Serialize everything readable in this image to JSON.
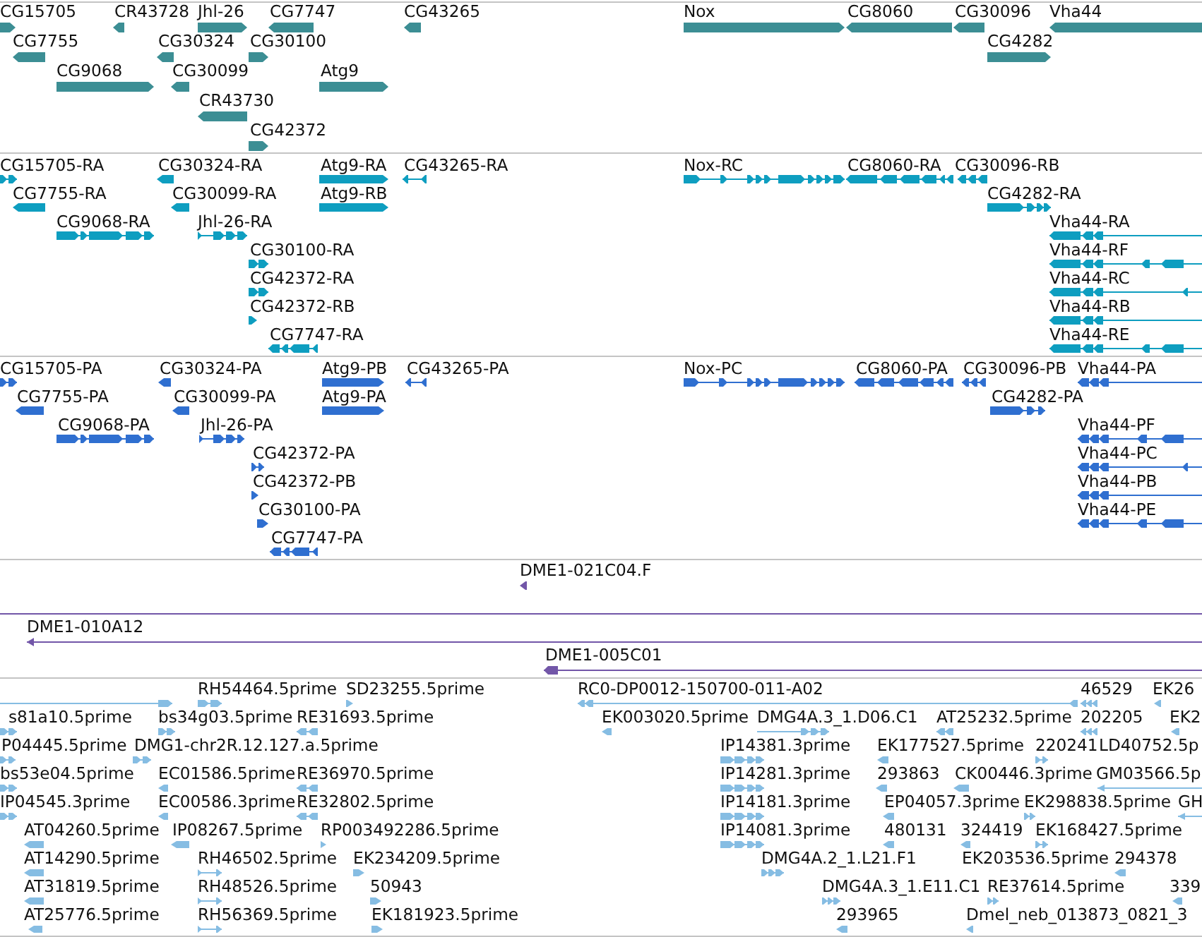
{
  "tracks": [
    {
      "kind": "gene",
      "color": "#3c8e94",
      "features": [
        {
          "label": "CG15705",
          "reverse": false
        },
        {
          "label": "CR43728",
          "reverse": true
        },
        {
          "label": "Jhl-26",
          "reverse": false
        },
        {
          "label": "CG7747",
          "reverse": true
        },
        {
          "label": "CG43265",
          "reverse": true
        },
        {
          "label": "Nox",
          "reverse": false
        },
        {
          "label": "CG8060",
          "reverse": true
        },
        {
          "label": "CG30096",
          "reverse": true
        },
        {
          "label": "Vha44",
          "reverse": true
        },
        {
          "label": "CG7755",
          "reverse": true
        },
        {
          "label": "CG30324",
          "reverse": true
        },
        {
          "label": "CG30100",
          "reverse": false
        },
        {
          "label": "CG4282",
          "reverse": false
        },
        {
          "label": "CG9068",
          "reverse": false
        },
        {
          "label": "CG30099",
          "reverse": true
        },
        {
          "label": "Atg9",
          "reverse": false
        },
        {
          "label": "CR43730",
          "reverse": true
        },
        {
          "label": "CG42372",
          "reverse": false
        }
      ]
    },
    {
      "kind": "transcript",
      "color": "#0e9ec0",
      "features": [
        {
          "label": "CG15705-RA",
          "reverse": false
        },
        {
          "label": "CG30324-RA",
          "reverse": true
        },
        {
          "label": "Atg9-RA",
          "reverse": false
        },
        {
          "label": "CG43265-RA",
          "reverse": true
        },
        {
          "label": "Nox-RC",
          "reverse": false
        },
        {
          "label": "CG8060-RA",
          "reverse": true
        },
        {
          "label": "CG30096-RB",
          "reverse": true
        },
        {
          "label": "CG7755-RA",
          "reverse": true
        },
        {
          "label": "CG30099-RA",
          "reverse": true
        },
        {
          "label": "Atg9-RB",
          "reverse": false
        },
        {
          "label": "CG4282-RA",
          "reverse": false
        },
        {
          "label": "CG9068-RA",
          "reverse": false
        },
        {
          "label": "Jhl-26-RA",
          "reverse": false
        },
        {
          "label": "Vha44-RA",
          "reverse": true
        },
        {
          "label": "CG30100-RA",
          "reverse": false
        },
        {
          "label": "Vha44-RF",
          "reverse": true
        },
        {
          "label": "CG42372-RA",
          "reverse": false
        },
        {
          "label": "Vha44-RC",
          "reverse": true
        },
        {
          "label": "CG42372-RB",
          "reverse": false
        },
        {
          "label": "Vha44-RB",
          "reverse": true
        },
        {
          "label": "CG7747-RA",
          "reverse": true
        },
        {
          "label": "Vha44-RE",
          "reverse": true
        }
      ]
    },
    {
      "kind": "protein",
      "color": "#2f6fd0",
      "features": [
        {
          "label": "CG15705-PA",
          "reverse": false
        },
        {
          "label": "CG30324-PA",
          "reverse": true
        },
        {
          "label": "Atg9-PB",
          "reverse": false
        },
        {
          "label": "CG43265-PA",
          "reverse": true
        },
        {
          "label": "Nox-PC",
          "reverse": false
        },
        {
          "label": "CG8060-PA",
          "reverse": true
        },
        {
          "label": "CG30096-PB",
          "reverse": true
        },
        {
          "label": "Vha44-PA",
          "reverse": true
        },
        {
          "label": "CG7755-PA",
          "reverse": true
        },
        {
          "label": "CG30099-PA",
          "reverse": true
        },
        {
          "label": "Atg9-PA",
          "reverse": false
        },
        {
          "label": "CG4282-PA",
          "reverse": false
        },
        {
          "label": "CG9068-PA",
          "reverse": false
        },
        {
          "label": "Jhl-26-PA",
          "reverse": false
        },
        {
          "label": "Vha44-PF",
          "reverse": true
        },
        {
          "label": "CG42372-PA",
          "reverse": false
        },
        {
          "label": "Vha44-PC",
          "reverse": true
        },
        {
          "label": "CG42372-PB",
          "reverse": false
        },
        {
          "label": "Vha44-PB",
          "reverse": true
        },
        {
          "label": "CG30100-PA",
          "reverse": false
        },
        {
          "label": "Vha44-PE",
          "reverse": true
        },
        {
          "label": "CG7747-PA",
          "reverse": true
        }
      ]
    },
    {
      "kind": "clone",
      "color": "#7256a8",
      "features": [
        {
          "kind": "arrow",
          "label": "DME1-021C04.F",
          "reverse": true
        },
        {
          "kind": "span"
        },
        {
          "kind": "arrow",
          "label": "DME1-010A12",
          "reverse": true
        },
        {
          "kind": "arrow",
          "label": "DME1-005C01",
          "reverse": true
        }
      ]
    },
    {
      "kind": "est",
      "color": "#86bde3",
      "features": [
        {
          "reverse": false
        },
        {
          "label": "RH54464.5prime",
          "reverse": false
        },
        {
          "label": "SD23255.5prime",
          "reverse": false
        },
        {
          "label": "RC0-DP0012-150700-011-A02",
          "reverse": true
        },
        {
          "label": "46529",
          "reverse": true
        },
        {
          "label": "EK26",
          "reverse": true
        },
        {
          "label": "s81a10.5prime",
          "reverse": false
        },
        {
          "label": "bs34g03.5prime",
          "reverse": false
        },
        {
          "label": "RE31693.5prime",
          "reverse": true
        },
        {
          "label": "EK003020.5prime",
          "reverse": true
        },
        {
          "label": "DMG4A.3_1.D06.C1",
          "reverse": false
        },
        {
          "label": "AT25232.5prime",
          "reverse": true
        },
        {
          "label": "202205",
          "reverse": true
        },
        {
          "label": "EK2",
          "reverse": true
        },
        {
          "label": "P04445.5prime",
          "reverse": false
        },
        {
          "label": "DMG1-chr2R.12.127.a.5prime",
          "reverse": false
        },
        {
          "label": "IP14381.3prime",
          "reverse": false
        },
        {
          "label": "EK177527.5prime",
          "reverse": true
        },
        {
          "label": "220241",
          "reverse": false
        },
        {
          "label": "LD40752.5p"
        },
        {
          "label": "bs53e04.5prime",
          "reverse": false
        },
        {
          "label": "EC01586.5prime",
          "reverse": true
        },
        {
          "label": "RE36970.5prime",
          "reverse": true
        },
        {
          "label": "IP14281.3prime",
          "reverse": false
        },
        {
          "label": "293863",
          "reverse": true
        },
        {
          "label": "CK00446.3prime",
          "reverse": true
        },
        {
          "label": "GM03566.5p",
          "reverse": true
        },
        {
          "label": "IP04545.3prime",
          "reverse": false
        },
        {
          "label": "EC00586.3prime",
          "reverse": true
        },
        {
          "label": "RE32802.5prime",
          "reverse": true
        },
        {
          "label": "IP14181.3prime",
          "reverse": false
        },
        {
          "label": "EP04057.3prime",
          "reverse": true
        },
        {
          "label": "EK298838.5prime",
          "reverse": false
        },
        {
          "label": "GH",
          "reverse": true
        },
        {
          "label": "AT04260.5prime",
          "reverse": true
        },
        {
          "label": "IP08267.5prime",
          "reverse": true
        },
        {
          "label": "RP003492286.5prime",
          "reverse": false
        },
        {
          "label": "IP14081.3prime",
          "reverse": false
        },
        {
          "label": "480131",
          "reverse": true
        },
        {
          "label": "324419",
          "reverse": true
        },
        {
          "label": "EK168427.5prime",
          "reverse": false
        },
        {
          "label": "AT14290.5prime",
          "reverse": true
        },
        {
          "label": "RH46502.5prime",
          "reverse": false
        },
        {
          "label": "EK234209.5prime",
          "reverse": false
        },
        {
          "label": "DMG4A.2_1.L21.F1",
          "reverse": false
        },
        {
          "label": "EK203536.5prime"
        },
        {
          "label": "294378",
          "reverse": true
        },
        {
          "label": "AT31819.5prime",
          "reverse": true
        },
        {
          "label": "RH48526.5prime",
          "reverse": false
        },
        {
          "label": "50943",
          "reverse": false
        },
        {
          "label": "DMG4A.3_1.E11.C1",
          "reverse": false
        },
        {
          "label": "RE37614.5prime",
          "reverse": false
        },
        {
          "label": "339",
          "reverse": true
        },
        {
          "label": "AT25776.5prime",
          "reverse": true
        },
        {
          "label": "RH56369.5prime",
          "reverse": false
        },
        {
          "label": "EK181923.5prime",
          "reverse": false
        },
        {
          "label": "293965",
          "reverse": true
        },
        {
          "label": "Dmel_neb_013873_0821_3",
          "reverse": true
        }
      ]
    }
  ]
}
